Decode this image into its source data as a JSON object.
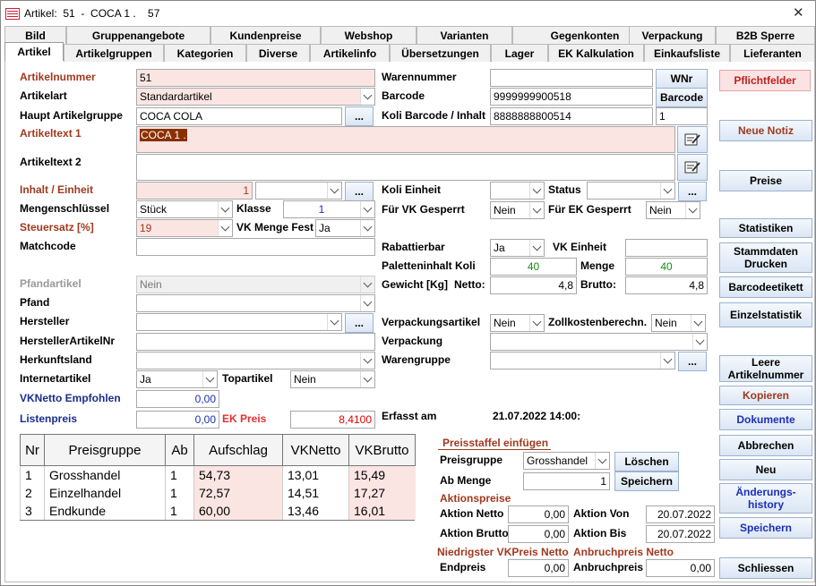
{
  "window": {
    "title": "Artikel:  51  -  COCA 1 .    57",
    "close_glyph": "✕"
  },
  "tabs_row1": [
    "Bild",
    "Gruppenangebote",
    "Kundenpreise",
    "Webshop",
    "Varianten",
    "Gegenkonten",
    "Verpackung",
    "B2B Sperre"
  ],
  "tabs_row2": [
    "Artikel",
    "Artikelgruppen",
    "Kategorien",
    "Diverse",
    "Artikelinfo",
    "Übersetzungen",
    "Lager",
    "EK Kalkulation",
    "Einkaufsliste",
    "Lieferanten"
  ],
  "left": {
    "artikelnummer": {
      "label": "Artikelnummer",
      "value": "51"
    },
    "artikelart": {
      "label": "Artikelart",
      "value": "Standardartikel"
    },
    "hauptgruppe": {
      "label": "Haupt Artikelgruppe",
      "value": "COCA COLA",
      "button": "..."
    },
    "artikeltext1": {
      "label": "Artikeltext 1",
      "value": "COCA 1 ."
    },
    "artikeltext2": {
      "label": "Artikeltext 2",
      "value": ""
    },
    "inhalt": {
      "label": "Inhalt / Einheit",
      "value": "1",
      "unit": "",
      "button": "..."
    },
    "mengenschluessel": {
      "label": "Mengenschlüssel",
      "value": "Stück"
    },
    "klasse": {
      "label": "Klasse",
      "value": "1"
    },
    "steuersatz": {
      "label": "Steuersatz [%]",
      "value": "19"
    },
    "vkmengefest": {
      "label": "VK Menge Fest",
      "value": "Ja"
    },
    "matchcode": {
      "label": "Matchcode",
      "value": ""
    },
    "pfandartikel": {
      "label": "Pfandartikel",
      "value": "Nein"
    },
    "pfand": {
      "label": "Pfand",
      "value": ""
    },
    "hersteller": {
      "label": "Hersteller",
      "value": "",
      "button": "..."
    },
    "herstellerartikelnr": {
      "label": "HerstellerArtikelNr",
      "value": ""
    },
    "herkunftsland": {
      "label": "Herkunftsland",
      "value": ""
    },
    "internetartikel": {
      "label": "Internetartikel",
      "value": "Ja"
    },
    "topartikel": {
      "label": "Topartikel",
      "value": "Nein"
    },
    "vknetto_empf": {
      "label": "VKNetto Empfohlen",
      "value": "0,00"
    },
    "listenpreis": {
      "label": "Listenpreis",
      "value": "0,00"
    },
    "ekpreis": {
      "label": "EK Preis",
      "value": "8,4100"
    }
  },
  "middle": {
    "warennummer": {
      "label": "Warennummer",
      "value": "",
      "button": "WNr"
    },
    "barcode": {
      "label": "Barcode",
      "value": "9999999900518",
      "button": "Barcode"
    },
    "kolibarcode": {
      "label": "Koli Barcode / Inhalt",
      "value": "8888888800514",
      "inhalt": "1"
    },
    "kolieinheit": {
      "label": "Koli Einheit",
      "value": ""
    },
    "status": {
      "label": "Status",
      "value": "",
      "button": "..."
    },
    "fuervk": {
      "label": "Für VK Gesperrt",
      "value": "Nein"
    },
    "fuerek": {
      "label": "Für EK Gesperrt",
      "value": "Nein"
    },
    "rabattierbar": {
      "label": "Rabattierbar",
      "value": "Ja"
    },
    "vkeinheit": {
      "label": "VK Einheit",
      "value": ""
    },
    "paletteninhalt": {
      "label": "Paletteninhalt Koli",
      "value": "40"
    },
    "menge": {
      "label": "Menge",
      "value": "40"
    },
    "gewicht": {
      "label": "Gewicht [Kg]",
      "netto_label": "Netto:",
      "netto": "4,8",
      "brutto_label": "Brutto:",
      "brutto": "4,8"
    },
    "verpackungsartikel": {
      "label": "Verpackungsartikel",
      "value": "Nein"
    },
    "zollkosten": {
      "label": "Zollkostenberechn.",
      "value": "Nein"
    },
    "verpackung": {
      "label": "Verpackung",
      "value": ""
    },
    "warengruppe": {
      "label": "Warengruppe",
      "value": "",
      "button": "..."
    },
    "erfasst": {
      "label": "Erfasst am",
      "value": "21.07.2022 14:00:"
    }
  },
  "grid": {
    "columns": [
      "Nr",
      "Preisgruppe",
      "Ab",
      "Aufschlag",
      "VKNetto",
      "VKBrutto"
    ],
    "rows": [
      [
        "1",
        "Grosshandel",
        "1",
        "54,73",
        "13,01",
        "15,49"
      ],
      [
        "2",
        "Einzelhandel",
        "1",
        "72,57",
        "14,51",
        "17,27"
      ],
      [
        "3",
        "Endkunde",
        "1",
        "60,00",
        "13,46",
        "16,01"
      ]
    ]
  },
  "staffel": {
    "title": "Preisstaffel einfügen",
    "preisgruppe_label": "Preisgruppe",
    "preisgruppe": "Grosshandel",
    "abmenge_label": "Ab Menge",
    "abmenge": "1",
    "loeschen": "Löschen",
    "speichern": "Speichern"
  },
  "aktion": {
    "title": "Aktionspreise",
    "netto_label": "Aktion Netto",
    "netto": "0,00",
    "brutto_label": "Aktion Brutto",
    "brutto": "0,00",
    "von_label": "Aktion Von",
    "von": "20.07.2022",
    "bis_label": "Aktion Bis",
    "bis": "20.07.2022"
  },
  "niedrig": {
    "title": "Niedrigster VKPreis Netto",
    "label": "Endpreis",
    "value": "0,00"
  },
  "anbruch": {
    "title": "Anbruchpreis Netto",
    "label": "Anbruchpreis",
    "value": "0,00"
  },
  "side_buttons": {
    "pflichtfelder": "Pflichtfelder",
    "neuenotiz": "Neue Notiz",
    "preise": "Preise",
    "statistiken": "Statistiken",
    "stammdaten": "Stammdaten Drucken",
    "barcodeetikett": "Barcodeetikett",
    "einzelstatistik": "Einzelstatistik",
    "leere": "Leere Artikelnummer",
    "kopieren": "Kopieren",
    "dokumente": "Dokumente",
    "abbrechen": "Abbrechen",
    "neu": "Neu",
    "aenderungshistory": "Änderungs-history",
    "speichern": "Speichern",
    "schliessen": "Schliessen"
  },
  "colors": {
    "required_bg": "#fbe5e3",
    "label_red": "#a0391e",
    "accent_blue": "#1a2fb8",
    "green": "#1a8a1a"
  }
}
